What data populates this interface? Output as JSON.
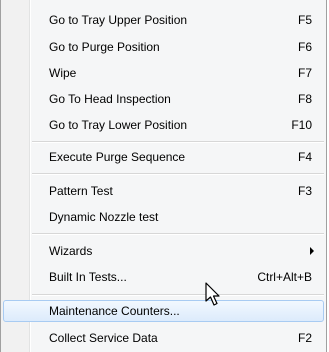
{
  "menu": {
    "items": [
      {
        "label": "Go to Tray Upper Position",
        "shortcut": "F5"
      },
      {
        "label": "Go to Purge Position",
        "shortcut": "F6"
      },
      {
        "label": "Wipe",
        "shortcut": "F7"
      },
      {
        "label": "Go To Head Inspection",
        "shortcut": "F8"
      },
      {
        "label": "Go to Tray Lower Position",
        "shortcut": "F10"
      },
      {
        "label": "Execute Purge Sequence",
        "shortcut": "F4"
      },
      {
        "label": "Pattern Test",
        "shortcut": "F3"
      },
      {
        "label": "Dynamic Nozzle test",
        "shortcut": ""
      },
      {
        "label": "Wizards",
        "shortcut": ""
      },
      {
        "label": "Built In Tests...",
        "shortcut": "Ctrl+Alt+B"
      },
      {
        "label": "Maintenance Counters...",
        "shortcut": ""
      },
      {
        "label": "Collect Service Data",
        "shortcut": "F2"
      }
    ],
    "highlighted_item": "Maintenance Counters...",
    "colors": {
      "background": "#f5f6f7",
      "highlight_border": "#a8cbf2",
      "highlight_fill": "#dcebfc"
    },
    "icons": {
      "submenu_arrow": "chevron-right-icon",
      "cursor": "mouse-pointer-icon"
    }
  }
}
